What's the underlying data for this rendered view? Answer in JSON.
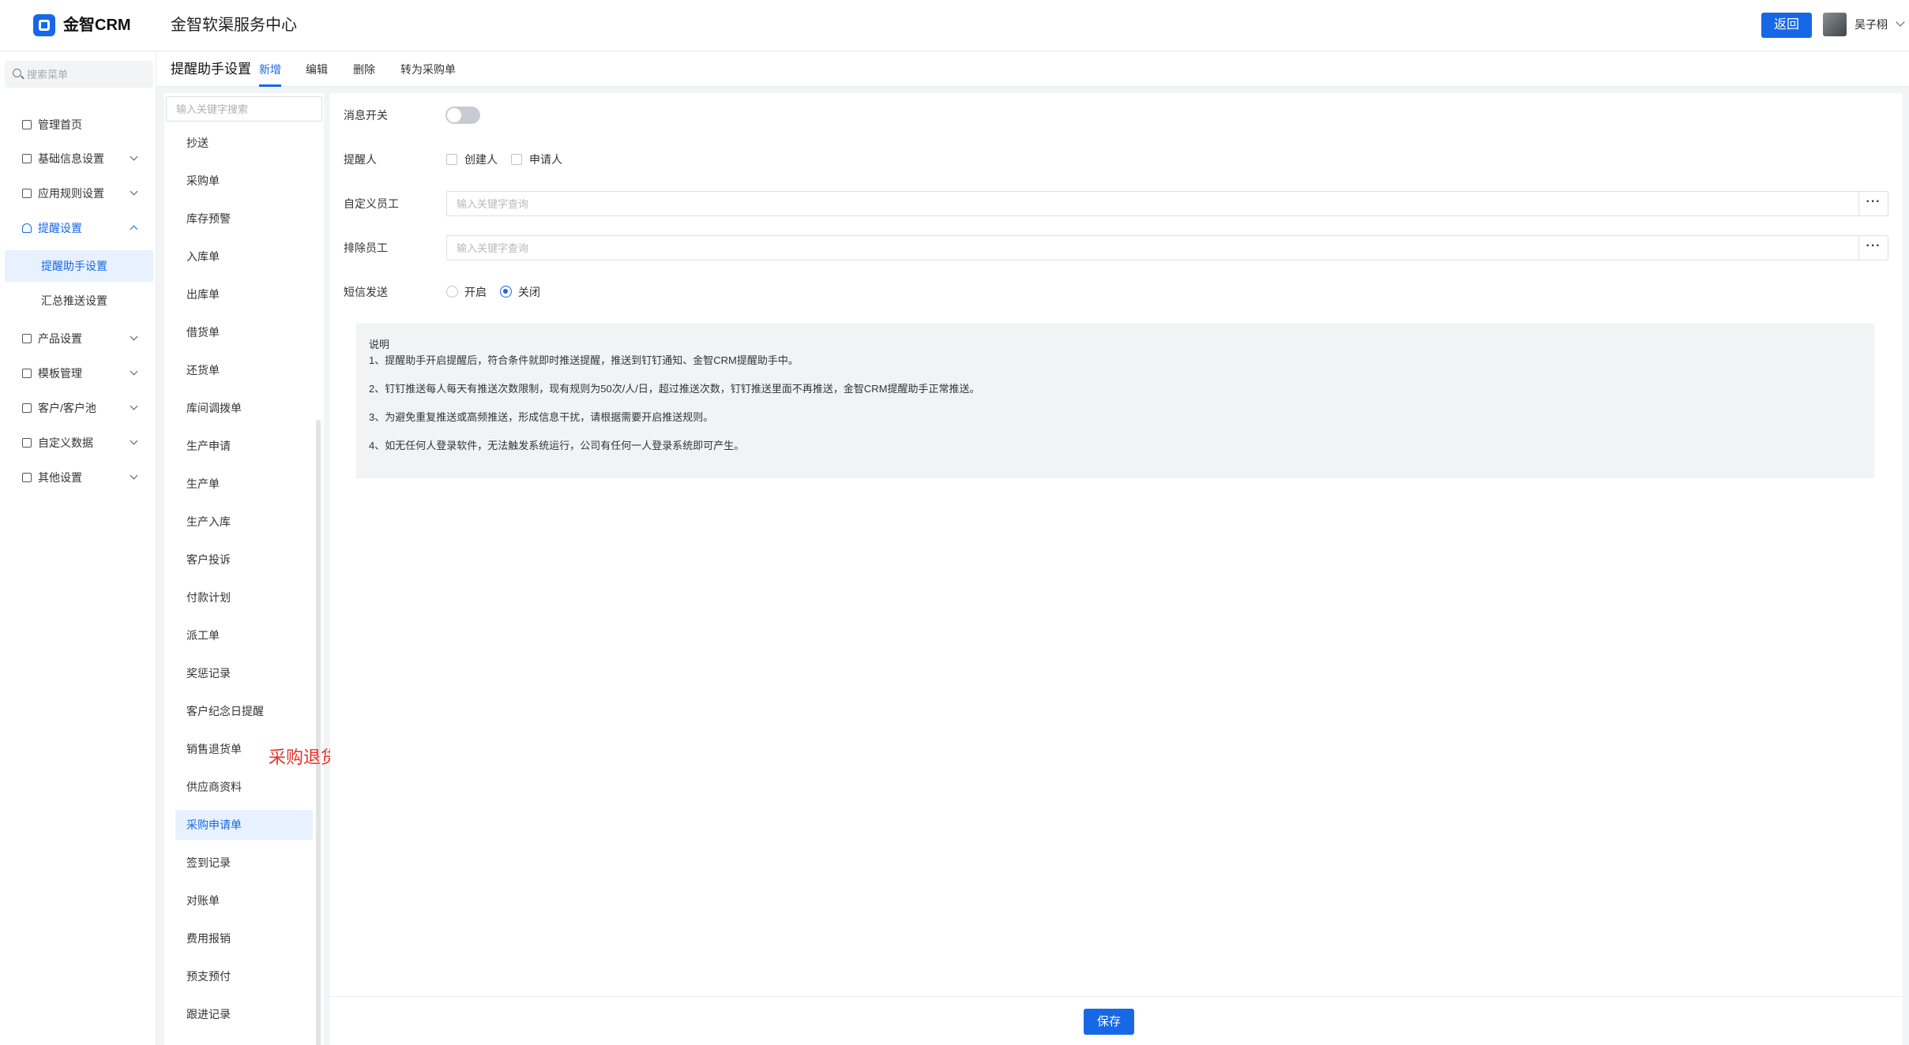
{
  "header": {
    "brand": "金智CRM",
    "title": "金智软渠服务中心",
    "back_label": "返回",
    "username": "吴子栩",
    "accent": "#1768e6"
  },
  "sidebar": {
    "search_placeholder": "搜索菜单",
    "items": [
      {
        "label": "管理首页",
        "icon": "home-icon"
      },
      {
        "label": "基础信息设置",
        "icon": "cube-icon"
      },
      {
        "label": "应用规则设置",
        "icon": "document-icon"
      },
      {
        "label": "提醒设置",
        "icon": "bell-icon"
      },
      {
        "label": "产品设置",
        "icon": "cube-icon"
      },
      {
        "label": "模板管理",
        "icon": "template-icon"
      },
      {
        "label": "客户/客户池",
        "icon": "customer-icon"
      },
      {
        "label": "自定义数据",
        "icon": "custom-data-icon"
      },
      {
        "label": "其他设置",
        "icon": "grid-icon"
      }
    ],
    "sub_items": [
      {
        "label": "提醒助手设置",
        "active": true
      },
      {
        "label": "汇总推送设置",
        "active": false
      }
    ]
  },
  "page": {
    "title": "提醒助手设置",
    "tabs": [
      "新增",
      "编辑",
      "删除",
      "转为采购单"
    ]
  },
  "list": {
    "search_placeholder": "输入关键字搜索",
    "items": [
      "抄送",
      "采购单",
      "库存预警",
      "入库单",
      "出库单",
      "借货单",
      "还货单",
      "库间调拨单",
      "生产申请",
      "生产单",
      "生产入库",
      "客户投诉",
      "付款计划",
      "派工单",
      "奖惩记录",
      "客户纪念日提醒",
      "销售退货单",
      "供应商资料",
      "采购申请单",
      "签到记录",
      "对账单",
      "费用报销",
      "预支预付",
      "跟进记录"
    ],
    "active_item": "采购申请单"
  },
  "annotation": {
    "text": "采购退货单",
    "color": "#e5332a"
  },
  "form": {
    "switch_label": "消息开关",
    "switch_on": false,
    "reminder_label": "提醒人",
    "reminder_options": [
      "创建人",
      "申请人"
    ],
    "custom_staff_label": "自定义员工",
    "custom_staff_placeholder": "输入关键字查询",
    "exclude_staff_label": "排除员工",
    "exclude_staff_placeholder": "输入关键字查询",
    "more_button": "···",
    "sms_label": "短信发送",
    "sms_options": [
      "开启",
      "关闭"
    ],
    "sms_selected": "关闭"
  },
  "notes": {
    "title": "说明",
    "lines": [
      "1、提醒助手开启提醒后，符合条件就即时推送提醒，推送到钉钉通知、金智CRM提醒助手中。",
      "2、钉钉推送每人每天有推送次数限制，现有规则为50次/人/日，超过推送次数，钉钉推送里面不再推送，金智CRM提醒助手正常推送。",
      "3、为避免重复推送或高频推送，形成信息干扰，请根据需要开启推送规则。",
      "4、如无任何人登录软件，无法触发系统运行，公司有任何一人登录系统即可产生。"
    ]
  },
  "footer": {
    "save_label": "保存"
  }
}
